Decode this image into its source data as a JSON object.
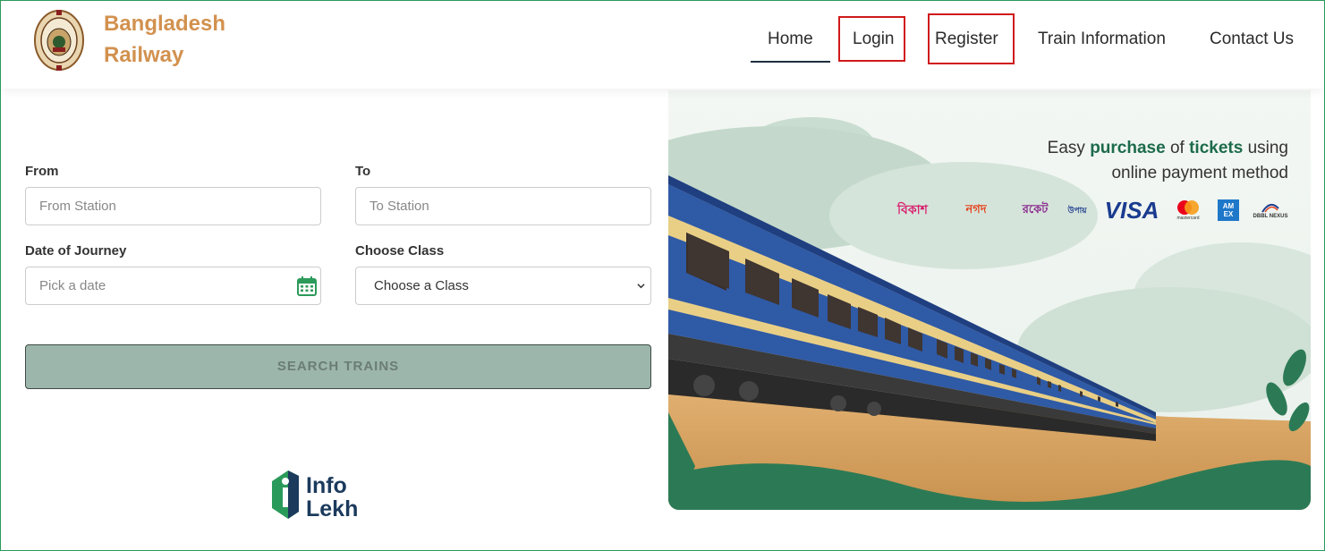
{
  "brand": {
    "line1": "Bangladesh",
    "line2": "Railway"
  },
  "nav": {
    "home": "Home",
    "login": "Login",
    "register": "Register",
    "train_info": "Train Information",
    "contact": "Contact Us"
  },
  "form": {
    "from_label": "From",
    "from_placeholder": "From Station",
    "to_label": "To",
    "to_placeholder": "To Station",
    "date_label": "Date of Journey",
    "date_placeholder": "Pick a date",
    "class_label": "Choose Class",
    "class_selected": "Choose a Class",
    "search_label": "SEARCH TRAINS"
  },
  "banner": {
    "line1_pre": "Easy ",
    "line1_b1": "purchase",
    "line1_mid": " of ",
    "line1_b2": "tickets",
    "line1_post": " using",
    "line2": "online payment method"
  },
  "payments": {
    "bkash": "বিকাশ",
    "nagad": "নগদ",
    "rocket": "রকেট",
    "upay": "উপায়",
    "visa": "VISA",
    "mastercard": "mastercard",
    "amex": "AM EX",
    "nexus": "DBBL NEXUS"
  },
  "footer_logo": {
    "line1": "Info",
    "line2": "Lekh"
  },
  "colors": {
    "brand": "#d2914f",
    "accent_green": "#1d6b4c",
    "button_bg": "#9cb6ab",
    "highlight_box": "#d01a1a"
  }
}
